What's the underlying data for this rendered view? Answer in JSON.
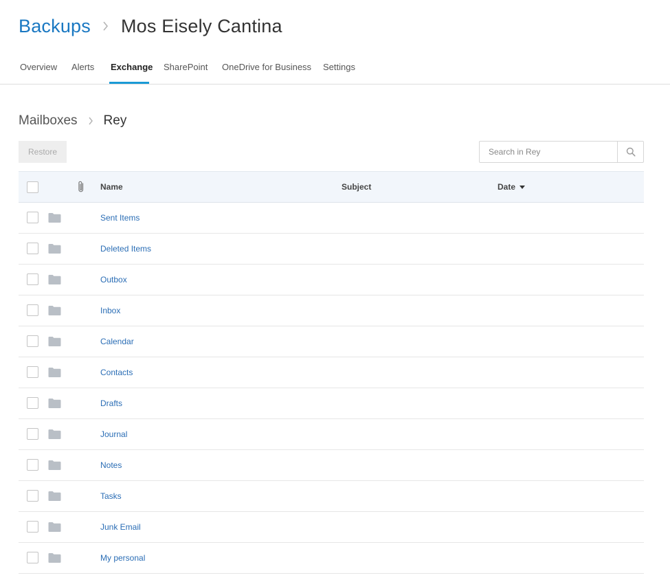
{
  "header": {
    "root_link": "Backups",
    "current": "Mos Eisely Cantina"
  },
  "tabs": [
    {
      "label": "Overview",
      "active": false
    },
    {
      "label": "Alerts",
      "active": false
    },
    {
      "label": "Exchange",
      "active": true
    },
    {
      "label": "SharePoint",
      "active": false
    },
    {
      "label": "OneDrive for Business",
      "active": false
    },
    {
      "label": "Settings",
      "active": false
    }
  ],
  "breadcrumb": {
    "parent": "Mailboxes",
    "current": "Rey"
  },
  "toolbar": {
    "restore_label": "Restore",
    "restore_enabled": false,
    "search_placeholder": "Search in Rey"
  },
  "table": {
    "columns": {
      "name": "Name",
      "subject": "Subject",
      "date": "Date"
    },
    "sort": {
      "column": "Date",
      "direction": "descending"
    },
    "rows": [
      {
        "name": "Sent Items"
      },
      {
        "name": "Deleted Items"
      },
      {
        "name": "Outbox"
      },
      {
        "name": "Inbox"
      },
      {
        "name": "Calendar"
      },
      {
        "name": "Contacts"
      },
      {
        "name": "Drafts"
      },
      {
        "name": "Journal"
      },
      {
        "name": "Notes"
      },
      {
        "name": "Tasks"
      },
      {
        "name": "Junk Email"
      },
      {
        "name": "My personal"
      }
    ]
  },
  "colors": {
    "accent": "#1a78c2",
    "tab_underline": "#1a9ad6",
    "link": "#2a6db5",
    "header_bg": "#f2f6fb",
    "folder": "#b9bfc6"
  }
}
